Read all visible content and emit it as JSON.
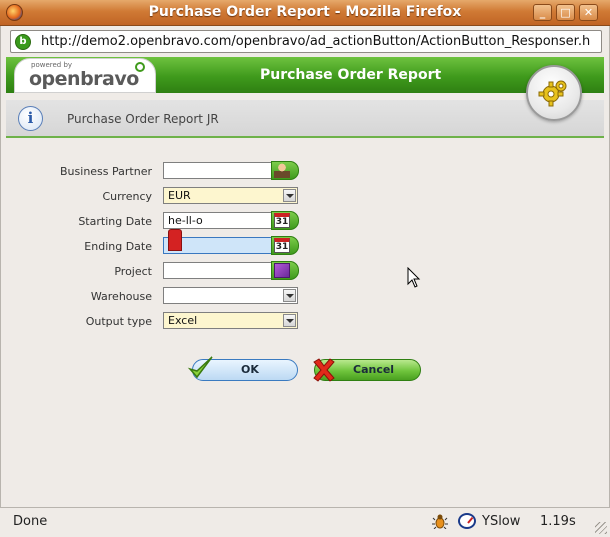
{
  "window": {
    "title": "Purchase Order Report - Mozilla Firefox",
    "minimize": "_",
    "maximize": "□",
    "close": "✕"
  },
  "browser": {
    "url": "http://demo2.openbravo.com/openbravo/ad_actionButton/ActionButton_Responser.h",
    "site_icon": "b"
  },
  "app": {
    "logo_tagline": "powered by",
    "logo_brand": "openbravo",
    "header_title": "Purchase Order Report",
    "sub_title": "Purchase Order Report JR",
    "info_icon": "i"
  },
  "form": {
    "business_partner": {
      "label": "Business Partner",
      "value": ""
    },
    "currency": {
      "label": "Currency",
      "value": "EUR"
    },
    "starting_date": {
      "label": "Starting Date",
      "value": "he-ll-o",
      "calendar_day": "31"
    },
    "ending_date": {
      "label": "Ending Date",
      "value": "",
      "calendar_day": "31"
    },
    "project": {
      "label": "Project",
      "value": ""
    },
    "warehouse": {
      "label": "Warehouse",
      "value": ""
    },
    "output_type": {
      "label": "Output type",
      "value": "Excel"
    }
  },
  "buttons": {
    "ok": "OK",
    "cancel": "Cancel"
  },
  "status": {
    "text": "Done",
    "yslow": "YSlow",
    "time": "1.19s"
  },
  "colors": {
    "accent_green": "#3f9a1c",
    "titlebar_orange": "#d07a35",
    "field_yellow": "#fdf6cf",
    "field_focus": "#cfe5f9"
  }
}
